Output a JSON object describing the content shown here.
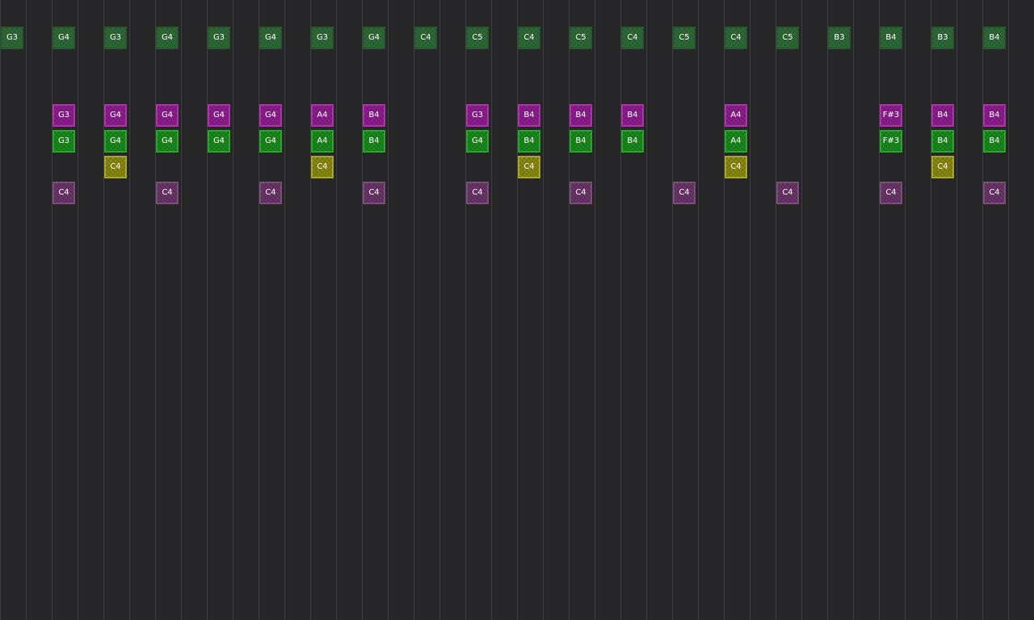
{
  "sequencer": {
    "colors": {
      "melody": "#2f6b38",
      "high": "#8d1e8f",
      "mid": "#1b8a1e",
      "yellow": "#8a8a10",
      "bass": "#6a3768",
      "background": "#262628",
      "gridline": "#3f3f42"
    },
    "melody": [
      "G3",
      "G4",
      "G3",
      "G4",
      "G3",
      "G4",
      "G3",
      "G4",
      "C4",
      "C5",
      "C4",
      "C5",
      "C4",
      "C5",
      "C4",
      "C5",
      "B3",
      "B4",
      "B3",
      "B4"
    ],
    "high": [
      "",
      "G3",
      "G4",
      "G4",
      "G4",
      "G4",
      "A4",
      "B4",
      "",
      "G3",
      "B4",
      "B4",
      "B4",
      "",
      "A4",
      "",
      "",
      "F#3",
      "B4",
      "B4"
    ],
    "mid": [
      "",
      "G3",
      "G4",
      "G4",
      "G4",
      "G4",
      "A4",
      "B4",
      "",
      "G4",
      "B4",
      "B4",
      "B4",
      "",
      "A4",
      "",
      "",
      "F#3",
      "B4",
      "B4"
    ],
    "yellow": [
      "",
      "",
      "C4",
      "",
      "",
      "",
      "C4",
      "",
      "",
      "",
      "C4",
      "",
      "",
      "",
      "C4",
      "",
      "",
      "",
      "C4",
      ""
    ],
    "bass": [
      "",
      "C4",
      "",
      "C4",
      "",
      "C4",
      "",
      "C4",
      "",
      "C4",
      "",
      "C4",
      "",
      "C4",
      "",
      "C4",
      "",
      "C4",
      "",
      "C4"
    ]
  }
}
